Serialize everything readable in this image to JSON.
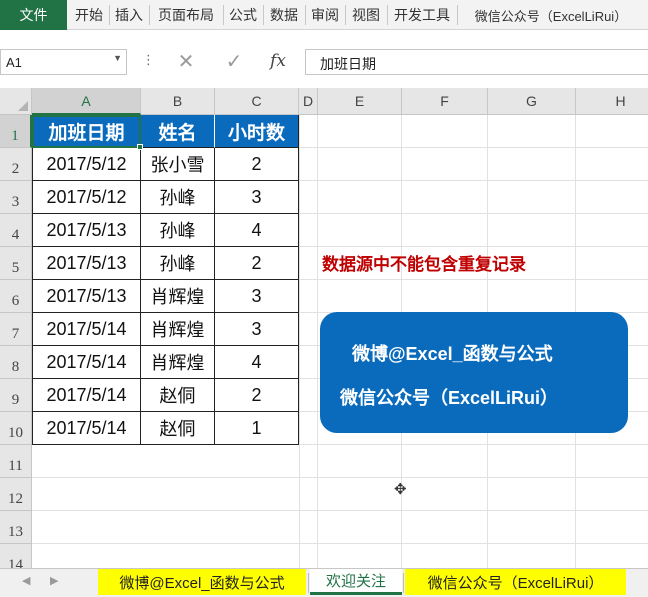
{
  "ribbon": {
    "file_tab": "文件",
    "tabs": [
      "开始",
      "插入",
      "页面布局",
      "公式",
      "数据",
      "审阅",
      "视图",
      "开发工具",
      "微信公众号（ExcelLiRui）"
    ]
  },
  "formula_bar": {
    "name_box": "A1",
    "name_box_dropdown": "▼",
    "dots": "⋮",
    "cancel_symbol": "✕",
    "enter_symbol": "✓",
    "fx_symbol": "fx",
    "content": "加班日期"
  },
  "sheet": {
    "columns": [
      "A",
      "B",
      "C",
      "D",
      "E",
      "F",
      "G",
      "H"
    ],
    "selected_column": "A",
    "rows": [
      "1",
      "2",
      "3",
      "4",
      "5",
      "6",
      "7",
      "8",
      "9",
      "10",
      "11",
      "12",
      "13",
      "14"
    ],
    "selected_row": "1",
    "table": {
      "headers": [
        "加班日期",
        "姓名",
        "小时数"
      ],
      "rows": [
        [
          "2017/5/12",
          "张小雪",
          "2"
        ],
        [
          "2017/5/12",
          "孙峰",
          "3"
        ],
        [
          "2017/5/13",
          "孙峰",
          "4"
        ],
        [
          "2017/5/13",
          "孙峰",
          "2"
        ],
        [
          "2017/5/13",
          "肖辉煌",
          "3"
        ],
        [
          "2017/5/14",
          "肖辉煌",
          "3"
        ],
        [
          "2017/5/14",
          "肖辉煌",
          "4"
        ],
        [
          "2017/5/14",
          "赵侗",
          "2"
        ],
        [
          "2017/5/14",
          "赵侗",
          "1"
        ]
      ]
    },
    "note": "数据源中不能包含重复记录",
    "banner": {
      "line1": "微博@Excel_函数与公式",
      "line2": "微信公众号（ExcelLiRui）"
    },
    "cursor_symbol": "✥"
  },
  "sheet_tabs": {
    "nav_prev": "◀",
    "nav_next": "▶",
    "tabs": [
      {
        "label": "微博@Excel_函数与公式",
        "style": "yellow"
      },
      {
        "label": "欢迎关注",
        "style": "active"
      },
      {
        "label": "微信公众号（ExcelLiRui）",
        "style": "yellow"
      }
    ]
  },
  "colors": {
    "excel_green": "#217346",
    "header_blue": "#0a6bbd",
    "note_red": "#c00000",
    "tab_yellow": "#ffff00"
  }
}
